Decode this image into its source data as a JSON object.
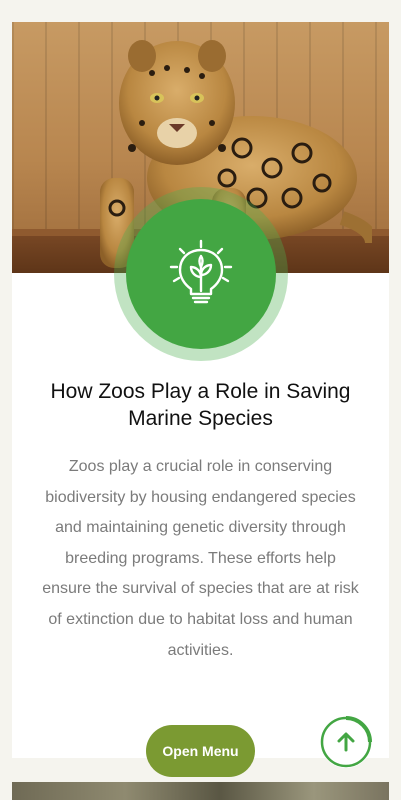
{
  "article": {
    "title": "How Zoos Play a Role in Saving Marine Species",
    "description": "Zoos play a crucial role in conserving biodiversity by housing endangered species and maintaining genetic diversity through breeding programs. These efforts help ensure the survival of species that are at risk of extinction due to habitat loss and human activities.",
    "image_icon": "jaguar-photo",
    "badge_icon": "lightbulb-plant-icon"
  },
  "actions": {
    "open_menu_label": "Open Menu",
    "scroll_top_icon": "arrow-up-icon"
  },
  "colors": {
    "accent_green": "#43a643",
    "menu_button": "#7b9a32",
    "background": "#f5f4ee"
  }
}
